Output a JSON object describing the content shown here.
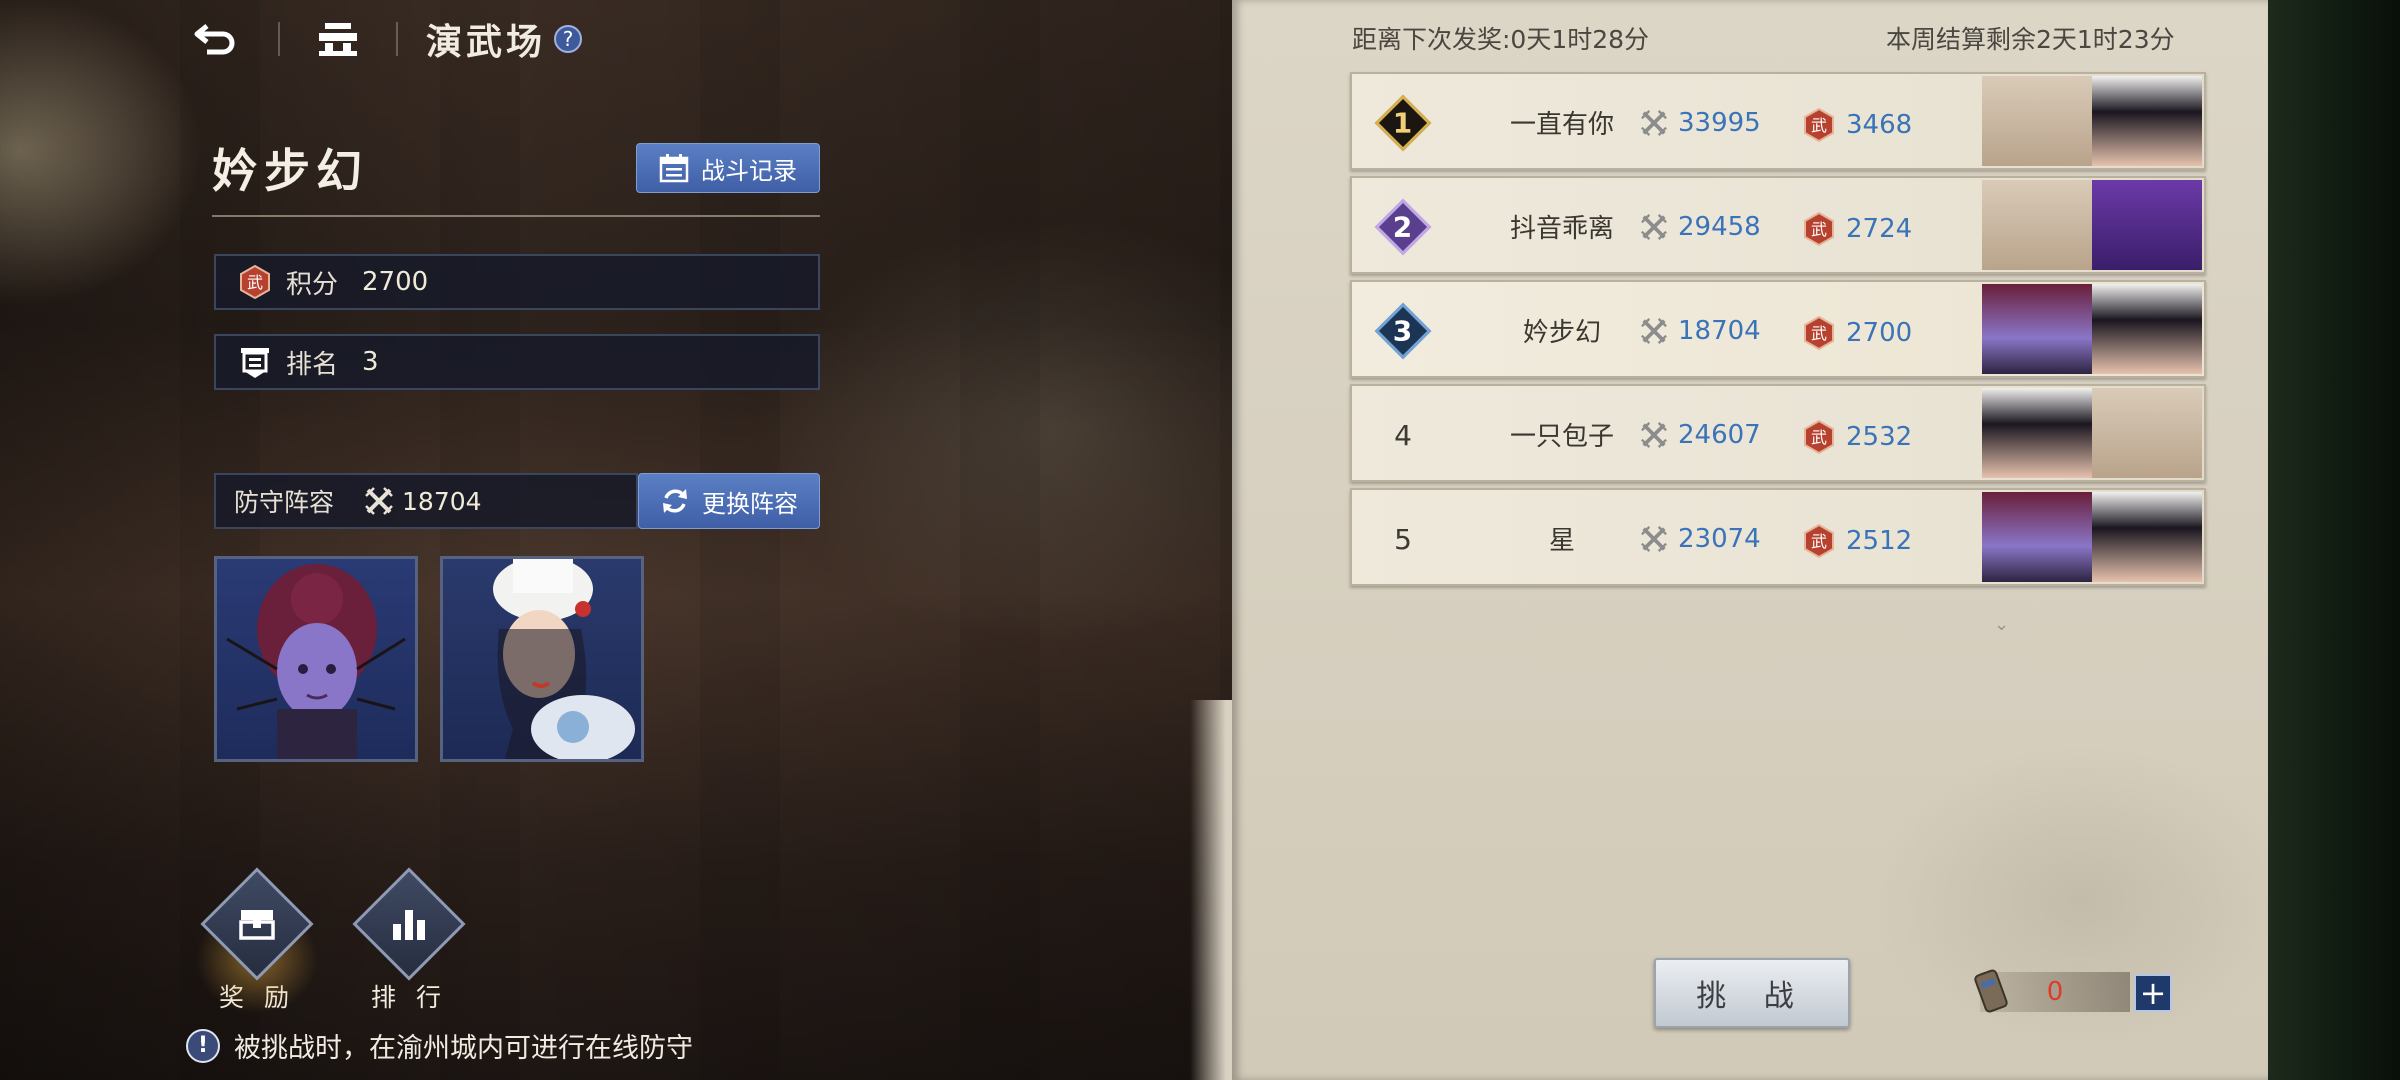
{
  "topbar": {
    "title": "演武场",
    "help_label": "?"
  },
  "player": {
    "name": "妗步幻",
    "battle_log_label": "战斗记录",
    "score_label": "积分",
    "score_value": "2700",
    "rank_label": "排名",
    "rank_value": "3",
    "defense_label": "防守阵容",
    "defense_power": "18704",
    "change_lineup_label": "更换阵容"
  },
  "bottom_actions": {
    "reward_label": "奖 励",
    "ranking_label": "排 行"
  },
  "notice": "被挑战时，在渝州城内可进行在线防守",
  "countdown": {
    "next_reward": "距离下次发奖:0天1时28分",
    "week_settle": "本周结算剩余2天1时23分"
  },
  "ranking": [
    {
      "rank": "1",
      "name": "一直有你",
      "power": "33995",
      "score": "3468"
    },
    {
      "rank": "2",
      "name": "抖音乖离",
      "power": "29458",
      "score": "2724"
    },
    {
      "rank": "3",
      "name": "妗步幻",
      "power": "18704",
      "score": "2700"
    },
    {
      "rank": "4",
      "name": "一只包子",
      "power": "24607",
      "score": "2532"
    },
    {
      "rank": "5",
      "name": "星",
      "power": "23074",
      "score": "2512"
    }
  ],
  "challenge": {
    "button_label": "挑 战",
    "tickets": "0",
    "add_label": "+"
  },
  "colors": {
    "accent_blue": "#4a6cb3",
    "stat_blue": "#3a73b8",
    "ticket_red": "#e03a2a",
    "badge_gold": "#d8b04c"
  },
  "icons": {
    "back": "back-arrow-icon",
    "home": "home-icon",
    "help": "question-icon",
    "battle_log": "calendar-icon",
    "score": "martial-badge-icon",
    "rank": "rank-flag-icon",
    "power": "crossed-swords-icon",
    "change": "refresh-icon",
    "reward": "chest-icon",
    "ranking": "bar-chart-icon",
    "notice": "exclamation-icon",
    "ticket": "ticket-icon"
  }
}
